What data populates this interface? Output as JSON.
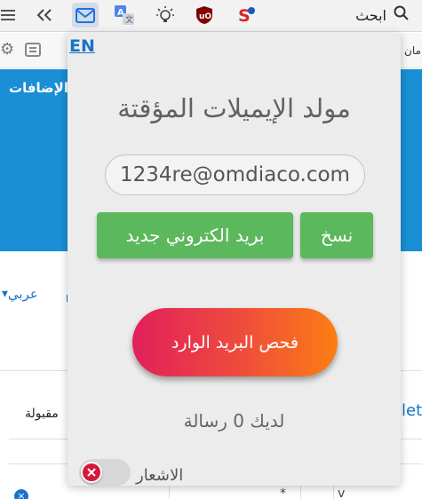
{
  "toolbar": {
    "search_label": "ابحث",
    "icons": [
      "hamburger-menu-icon",
      "double-chevron-icon",
      "mail-icon",
      "translate-icon",
      "lightbulb-icon",
      "ublock-icon",
      "s-extension-icon",
      "search-icon"
    ],
    "active_color": "#d3dbe6"
  },
  "background_page": {
    "toolbar_right_text": "امان",
    "blue_header_text": "الإضافات",
    "header_color": "#1a8fd6",
    "language_selector": "عربي",
    "accepted_label": "مقبولة",
    "right_link_text": "let",
    "bottom_cells": [
      "*",
      "v"
    ]
  },
  "popup": {
    "language_toggle": "EN",
    "title": "مولد الإيميلات المؤقتة",
    "email_value": "1234re@omdiaco.com",
    "new_email_button": "بريد الكتروني جديد",
    "copy_button": "نسخ",
    "check_inbox_button": "فحص البريد الوارد",
    "message_count_text": "لديك 0 رسالة",
    "notifications_label": "الاشعار",
    "notifications_enabled": false,
    "button_color": "#5cb85c",
    "gradient_colors": [
      "#e21f5b",
      "#fb7e13"
    ]
  }
}
